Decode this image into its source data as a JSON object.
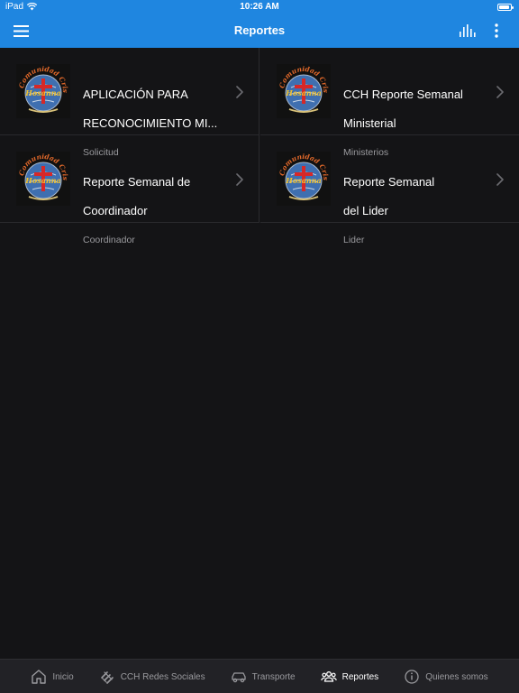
{
  "status": {
    "device": "iPad",
    "time": "10:26 AM",
    "battery_level": 0.9
  },
  "navbar": {
    "title": "Reportes",
    "menu_icon": "hamburger-icon",
    "stats_icon": "bar-chart-icon",
    "more_icon": "more-vertical-icon"
  },
  "reports": [
    {
      "title_line1": "APLICACIÓN PARA",
      "title_line2": "RECONOCIMIENTO MI...",
      "subtitle": "Solicitud"
    },
    {
      "title_line1": "CCH Reporte Semanal",
      "title_line2": "Ministerial",
      "subtitle": "Ministerios"
    },
    {
      "title_line1": "Reporte Semanal de",
      "title_line2": "Coordinador",
      "subtitle": "Coordinador"
    },
    {
      "title_line1": "Reporte Semanal",
      "title_line2": "del Lider",
      "subtitle": "Lider"
    }
  ],
  "logo": {
    "text_top": "Comunidad Cristiana",
    "text_center": "Hosanna"
  },
  "tabs": [
    {
      "label": "Inicio",
      "icon": "home-icon"
    },
    {
      "label": "CCH Redes Sociales",
      "icon": "social-network-icon"
    },
    {
      "label": "Transporte",
      "icon": "car-icon"
    },
    {
      "label": "Reportes",
      "icon": "people-icon",
      "active": true
    },
    {
      "label": "Quienes somos",
      "icon": "info-icon"
    }
  ],
  "colors": {
    "accent": "#1f86e0",
    "background": "#141416",
    "tabbar": "#222226",
    "subtitle": "#9a9a9e"
  }
}
